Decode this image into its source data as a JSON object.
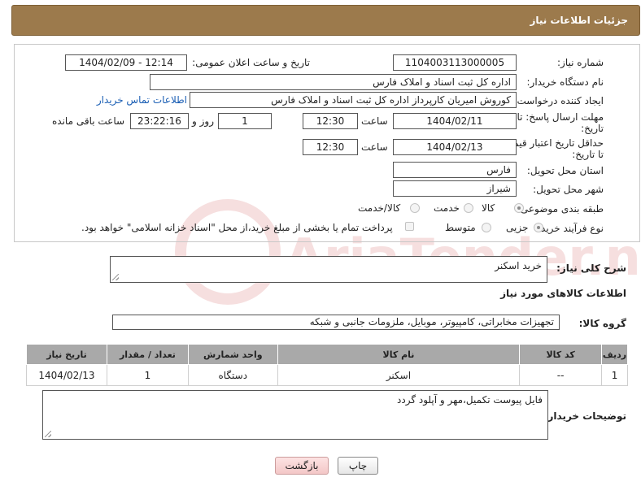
{
  "header": {
    "title": "جزئیات اطلاعات نیاز"
  },
  "fields": {
    "need_number": {
      "label": "شماره نیاز:",
      "value": "1104003113000005"
    },
    "announce_datetime": {
      "label": "تاریخ و ساعت اعلان عمومی:",
      "value": "1404/02/09 - 12:14"
    },
    "buyer_org": {
      "label": "نام دستگاه خریدار:",
      "value": "اداره کل ثبت اسناد و املاک فارس"
    },
    "requester": {
      "label": "ایجاد کننده درخواست:",
      "value": "کوروش امیریان کارپرداز اداره کل ثبت اسناد و املاک فارس",
      "contact_link": "اطلاعات تماس خریدار"
    },
    "reply_deadline": {
      "label_line1": "مهلت ارسال پاسخ: تا",
      "label_line2": "تاریخ:",
      "date": "1404/02/11",
      "time_label": "ساعت",
      "time": "12:30",
      "days": "1",
      "days_label": "روز و",
      "remaining": "23:22:16",
      "remaining_label": "ساعت باقی مانده"
    },
    "price_validity": {
      "label_line1": "حداقل تاریخ اعتبار قیمت:",
      "label_line2": "تا تاریخ:",
      "date": "1404/02/13",
      "time_label": "ساعت",
      "time": "12:30"
    },
    "delivery_province": {
      "label": "استان محل تحویل:",
      "value": "فارس"
    },
    "delivery_city": {
      "label": "شهر محل تحویل:",
      "value": "شیراز"
    },
    "category": {
      "label": "طبقه بندی موضوعی:",
      "options": [
        "کالا",
        "خدمت",
        "کالا/خدمت"
      ]
    },
    "purchase_type": {
      "label": "نوع فرآیند خرید :",
      "options": [
        "جزیی",
        "متوسط"
      ],
      "payment_note": "پرداخت تمام یا بخشی از مبلغ خرید،از محل \"اسناد خزانه اسلامی\" خواهد بود."
    }
  },
  "description": {
    "label": "شرح کلی نیاز:",
    "value": "خرید اسکنر"
  },
  "goods_section": {
    "title": "اطلاعات کالاهای مورد نیاز",
    "group_label": "گروه کالا:",
    "group_value": "تجهیزات مخابراتی، کامپیوتر، موبایل، ملزومات جانبی و شبکه"
  },
  "table": {
    "headers": [
      "ردیف",
      "کد کالا",
      "نام کالا",
      "واحد شمارش",
      "تعداد / مقدار",
      "تاریخ نیاز"
    ],
    "rows": [
      [
        "1",
        "--",
        "اسکنر",
        "دستگاه",
        "1",
        "1404/02/13"
      ]
    ]
  },
  "buyer_notes": {
    "label": "توضیحات خریدار:",
    "value": "فایل پیوست تکمیل،مهر و آپلود گردد"
  },
  "buttons": {
    "print": "چاپ",
    "back": "بازگشت"
  },
  "watermark": "AriaTender.net",
  "colors": {
    "header": "#9c7a4c",
    "link": "#1a5eb4",
    "table_header": "#a9a9a9",
    "back_button": "#f3c7c7"
  }
}
